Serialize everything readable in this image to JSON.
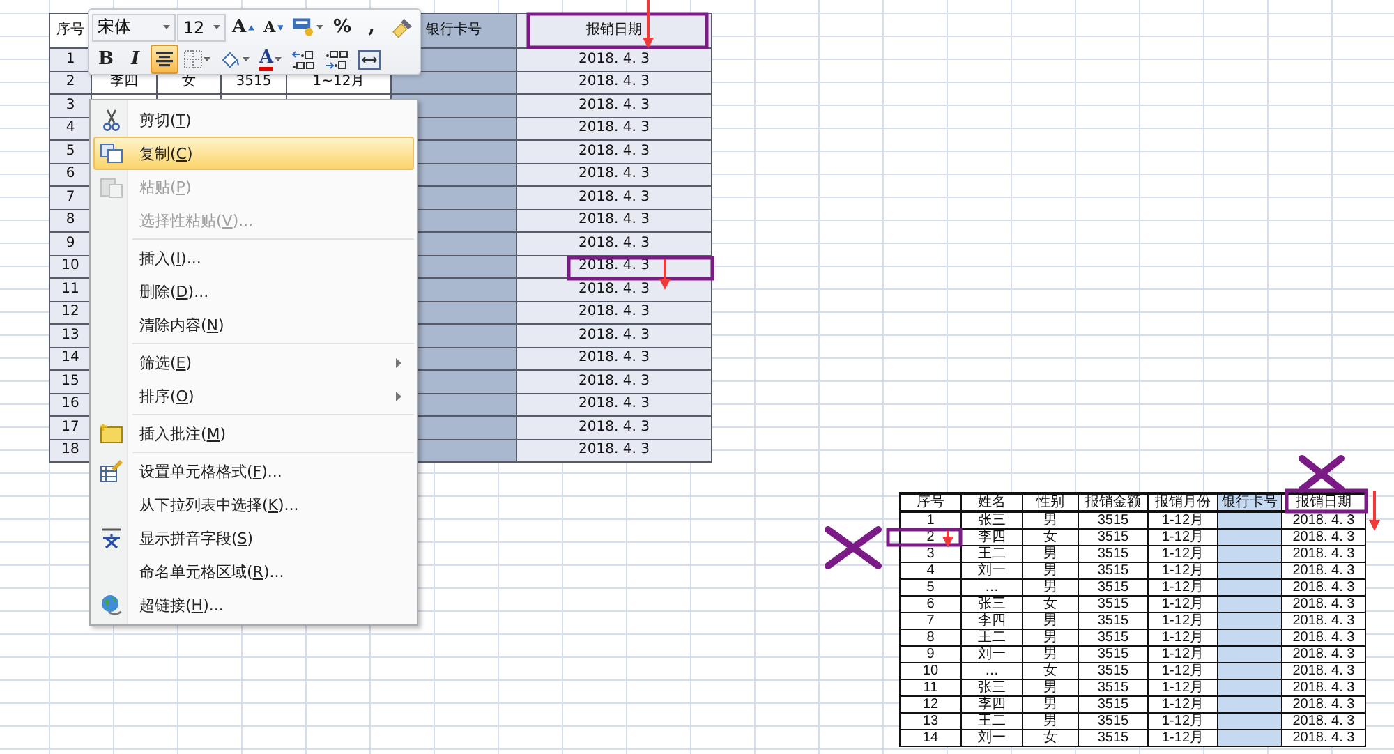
{
  "mini_toolbar": {
    "font": "宋体",
    "size": "12",
    "row1": [
      {
        "kind": "grow_font",
        "label": "A"
      },
      {
        "kind": "shrink_font",
        "label": "A"
      },
      {
        "kind": "styles"
      },
      {
        "kind": "percent",
        "label": "%"
      },
      {
        "kind": "comma",
        "label": ","
      },
      {
        "kind": "painter"
      }
    ],
    "row2": [
      {
        "kind": "bold",
        "label": "B",
        "selected": false
      },
      {
        "kind": "italic",
        "label": "I",
        "selected": false
      },
      {
        "kind": "align_center",
        "selected": true
      },
      {
        "kind": "borders"
      },
      {
        "kind": "fill_color"
      },
      {
        "kind": "font_color",
        "label": "A"
      },
      {
        "kind": "increase_decimal"
      },
      {
        "kind": "decrease_decimal"
      },
      {
        "kind": "merge"
      }
    ]
  },
  "context_menu": {
    "groups": [
      [
        {
          "before": "剪切(",
          "mnemonic": "T",
          "after": ")",
          "selected": false,
          "disabled": false,
          "submenu": false
        },
        {
          "before": "复制(",
          "mnemonic": "C",
          "after": ")",
          "selected": true,
          "disabled": false,
          "submenu": false
        },
        {
          "before": "粘贴(",
          "mnemonic": "P",
          "after": ")",
          "selected": false,
          "disabled": true,
          "submenu": false
        },
        {
          "before": "选择性粘贴(",
          "mnemonic": "V",
          "after": ")...",
          "selected": false,
          "disabled": true,
          "submenu": false
        }
      ],
      [
        {
          "before": "插入(",
          "mnemonic": "I",
          "after": ")...",
          "selected": false,
          "disabled": false,
          "submenu": false
        },
        {
          "before": "删除(",
          "mnemonic": "D",
          "after": ")...",
          "selected": false,
          "disabled": false,
          "submenu": false
        },
        {
          "before": "清除内容(",
          "mnemonic": "N",
          "after": ")",
          "selected": false,
          "disabled": false,
          "submenu": false
        }
      ],
      [
        {
          "before": "筛选(",
          "mnemonic": "E",
          "after": ")",
          "selected": false,
          "disabled": false,
          "submenu": true
        },
        {
          "before": "排序(",
          "mnemonic": "O",
          "after": ")",
          "selected": false,
          "disabled": false,
          "submenu": true
        }
      ],
      [
        {
          "before": "插入批注(",
          "mnemonic": "M",
          "after": ")",
          "selected": false,
          "disabled": false,
          "submenu": false
        }
      ],
      [
        {
          "before": "设置单元格格式(",
          "mnemonic": "F",
          "after": ")...",
          "selected": false,
          "disabled": false,
          "submenu": false
        },
        {
          "before": "从下拉列表中选择(",
          "mnemonic": "K",
          "after": ")...",
          "selected": false,
          "disabled": false,
          "submenu": false
        },
        {
          "before": "显示拼音字段(",
          "mnemonic": "S",
          "after": ")",
          "selected": false,
          "disabled": false,
          "submenu": false
        },
        {
          "before": "命名单元格区域(",
          "mnemonic": "R",
          "after": ")...",
          "selected": false,
          "disabled": false,
          "submenu": false
        },
        {
          "before": "超链接(",
          "mnemonic": "H",
          "after": ")...",
          "selected": false,
          "disabled": false,
          "submenu": false
        }
      ]
    ]
  },
  "left_table": {
    "header": {
      "no": "序号",
      "bank_card": "银行卡号",
      "date": "报销日期"
    },
    "rows": [
      {
        "no": "1",
        "date": "2018. 4. 3"
      },
      {
        "no": "2",
        "name": "李四",
        "gender": "女",
        "amount": "3515",
        "month": "1~12月",
        "date": "2018. 4. 3"
      },
      {
        "no": "3",
        "date": "2018. 4. 3"
      },
      {
        "no": "4",
        "date": "2018. 4. 3"
      },
      {
        "no": "5",
        "date": "2018. 4. 3"
      },
      {
        "no": "6",
        "date": "2018. 4. 3"
      },
      {
        "no": "7",
        "date": "2018. 4. 3"
      },
      {
        "no": "8",
        "date": "2018. 4. 3"
      },
      {
        "no": "9",
        "date": "2018. 4. 3"
      },
      {
        "no": "10",
        "date": "2018. 4. 3"
      },
      {
        "no": "11",
        "date": "2018. 4. 3"
      },
      {
        "no": "12",
        "date": "2018. 4. 3"
      },
      {
        "no": "13",
        "date": "2018. 4. 3"
      },
      {
        "no": "14",
        "date": "2018. 4. 3"
      },
      {
        "no": "15",
        "date": "2018. 4. 3"
      },
      {
        "no": "16",
        "date": "2018. 4. 3"
      },
      {
        "no": "17",
        "date": "2018. 4. 3"
      },
      {
        "no": "18",
        "date": "2018. 4. 3"
      }
    ]
  },
  "right_table": {
    "columns": [
      "序号",
      "姓名",
      "性别",
      "报销金额",
      "报销月份",
      "银行卡号",
      "报销日期"
    ],
    "rows": [
      {
        "no": "1",
        "name": "张三",
        "gender": "男",
        "amount": "3515",
        "month": "1-12月",
        "date": "2018. 4. 3"
      },
      {
        "no": "2",
        "name": "李四",
        "gender": "女",
        "amount": "3515",
        "month": "1-12月",
        "date": "2018. 4. 3"
      },
      {
        "no": "3",
        "name": "王二",
        "gender": "男",
        "amount": "3515",
        "month": "1-12月",
        "date": "2018. 4. 3"
      },
      {
        "no": "4",
        "name": "刘一",
        "gender": "男",
        "amount": "3515",
        "month": "1-12月",
        "date": "2018. 4. 3"
      },
      {
        "no": "5",
        "name": "…",
        "gender": "男",
        "amount": "3515",
        "month": "1-12月",
        "date": "2018. 4. 3"
      },
      {
        "no": "6",
        "name": "张三",
        "gender": "女",
        "amount": "3515",
        "month": "1-12月",
        "date": "2018. 4. 3"
      },
      {
        "no": "7",
        "name": "李四",
        "gender": "男",
        "amount": "3515",
        "month": "1-12月",
        "date": "2018. 4. 3"
      },
      {
        "no": "8",
        "name": "王二",
        "gender": "男",
        "amount": "3515",
        "month": "1-12月",
        "date": "2018. 4. 3"
      },
      {
        "no": "9",
        "name": "刘一",
        "gender": "男",
        "amount": "3515",
        "month": "1-12月",
        "date": "2018. 4. 3"
      },
      {
        "no": "10",
        "name": "…",
        "gender": "女",
        "amount": "3515",
        "month": "1-12月",
        "date": "2018. 4. 3"
      },
      {
        "no": "11",
        "name": "张三",
        "gender": "男",
        "amount": "3515",
        "month": "1-12月",
        "date": "2018. 4. 3"
      },
      {
        "no": "12",
        "name": "李四",
        "gender": "男",
        "amount": "3515",
        "month": "1-12月",
        "date": "2018. 4. 3"
      },
      {
        "no": "13",
        "name": "王二",
        "gender": "男",
        "amount": "3515",
        "month": "1-12月",
        "date": "2018. 4. 3"
      },
      {
        "no": "14",
        "name": "刘一",
        "gender": "女",
        "amount": "3515",
        "month": "1-12月",
        "date": "2018. 4. 3"
      }
    ]
  }
}
